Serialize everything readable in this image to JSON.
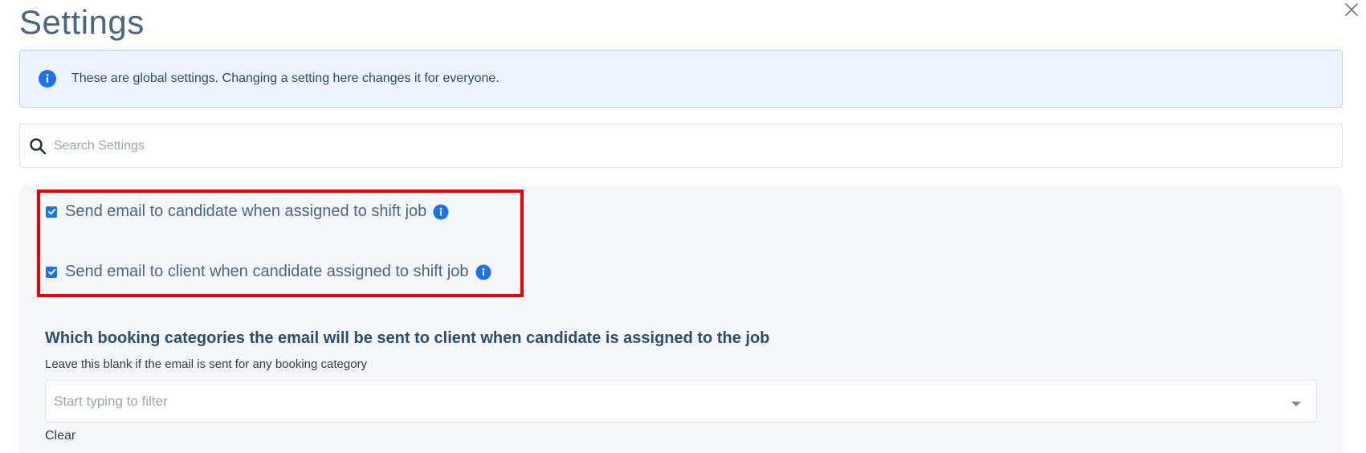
{
  "page": {
    "title": "Settings"
  },
  "banner": {
    "text": "These are global settings. Changing a setting here changes it for everyone.",
    "icon": "info-icon",
    "icon_color": "#1a73e8"
  },
  "search": {
    "placeholder": "Search Settings",
    "value": "",
    "icon": "search-icon"
  },
  "settings": [
    {
      "label": "Send email to candidate when assigned to shift job",
      "checked": true,
      "icon": "info-icon"
    },
    {
      "label": "Send email to client when candidate assigned to shift job",
      "checked": true,
      "icon": "info-icon"
    }
  ],
  "booking_categories": {
    "title": "Which booking categories the email will be sent to client when candidate is assigned to the job",
    "help": "Leave this blank if the email is sent for any booking category",
    "placeholder": "Start typing to filter",
    "clear_label": "Clear"
  },
  "colors": {
    "accent": "#1a73e8",
    "highlight_border": "#ee0000",
    "banner_bg": "#eef4fd",
    "panel_bg": "#f4f6f9"
  }
}
